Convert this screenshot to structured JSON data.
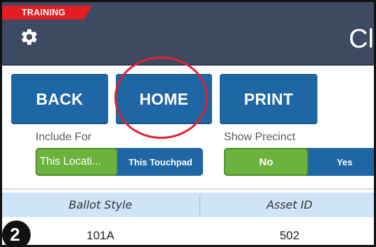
{
  "header": {
    "training_label": "TRAINING",
    "title_partial": "Cl",
    "settings_icon": "gear-icon"
  },
  "nav": {
    "back_label": "BACK",
    "home_label": "HOME",
    "print_label": "PRINT"
  },
  "include_for": {
    "label": "Include For",
    "options": [
      "This Locati...",
      "This Touchpad"
    ],
    "selected": "This Locati..."
  },
  "show_precinct": {
    "label": "Show Precinct",
    "options": [
      "No",
      "Yes"
    ],
    "selected": "No"
  },
  "table": {
    "columns": [
      "Ballot Style",
      "Asset ID"
    ],
    "rows": [
      [
        "101A",
        "502"
      ]
    ]
  },
  "step_badge": "2",
  "colors": {
    "header_bg": "#3e4a62",
    "button_blue": "#1f66a5",
    "selected_green": "#6cb33e",
    "training_red": "#e21d23",
    "annotation_red": "#e0232b",
    "table_header_bg": "#cfe4f6"
  }
}
